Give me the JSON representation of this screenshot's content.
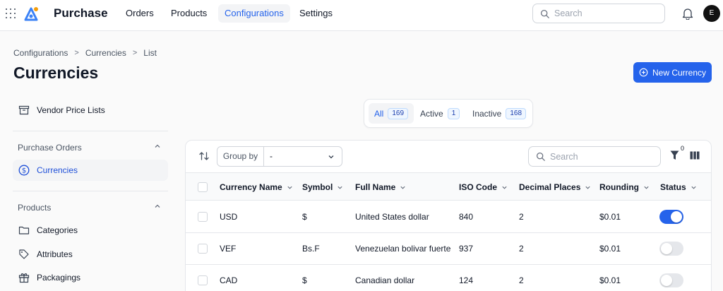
{
  "app": {
    "title": "Purchase",
    "avatar_initial": "E"
  },
  "nav": {
    "items": [
      {
        "label": "Orders",
        "active": false
      },
      {
        "label": "Products",
        "active": false
      },
      {
        "label": "Configurations",
        "active": true
      },
      {
        "label": "Settings",
        "active": false
      }
    ],
    "search_placeholder": "Search"
  },
  "breadcrumb": [
    "Configurations",
    "Currencies",
    "List"
  ],
  "page": {
    "title": "Currencies",
    "new_button_label": "New Currency"
  },
  "sidebar": {
    "top_item": "Vendor Price Lists",
    "groups": [
      {
        "label": "Purchase Orders",
        "items": [
          {
            "label": "Currencies",
            "active": true
          }
        ]
      },
      {
        "label": "Products",
        "items": [
          {
            "label": "Categories"
          },
          {
            "label": "Attributes"
          },
          {
            "label": "Packagings"
          }
        ]
      }
    ]
  },
  "tabs": [
    {
      "label": "All",
      "count": "169",
      "active": true
    },
    {
      "label": "Active",
      "count": "1",
      "active": false
    },
    {
      "label": "Inactive",
      "count": "168",
      "active": false
    }
  ],
  "toolbar": {
    "group_by_label": "Group by",
    "group_by_value": "-",
    "search_placeholder": "Search",
    "filter_count": "0"
  },
  "table": {
    "columns": [
      "Currency Name",
      "Symbol",
      "Full Name",
      "ISO Code",
      "Decimal Places",
      "Rounding",
      "Status"
    ],
    "rows": [
      {
        "name": "USD",
        "symbol": "$",
        "full_name": "United States dollar",
        "iso": "840",
        "decimals": "2",
        "rounding": "$0.01",
        "status": true
      },
      {
        "name": "VEF",
        "symbol": "Bs.F",
        "full_name": "Venezuelan bolivar fuerte",
        "iso": "937",
        "decimals": "2",
        "rounding": "$0.01",
        "status": false
      },
      {
        "name": "CAD",
        "symbol": "$",
        "full_name": "Canadian dollar",
        "iso": "124",
        "decimals": "2",
        "rounding": "$0.01",
        "status": false
      }
    ]
  },
  "colors": {
    "accent": "#2563eb",
    "toggle_off": "#e5e7eb"
  },
  "icons": [
    "apps-grid-icon",
    "logo-icon",
    "search-icon",
    "bell-icon",
    "plus-circle-icon",
    "archive-icon",
    "dollar-icon",
    "folder-icon",
    "tag-icon",
    "gift-icon",
    "sort-icon",
    "filter-icon",
    "columns-icon",
    "chevron-down-icon",
    "chevron-up-icon",
    "chevron-right-icon"
  ]
}
